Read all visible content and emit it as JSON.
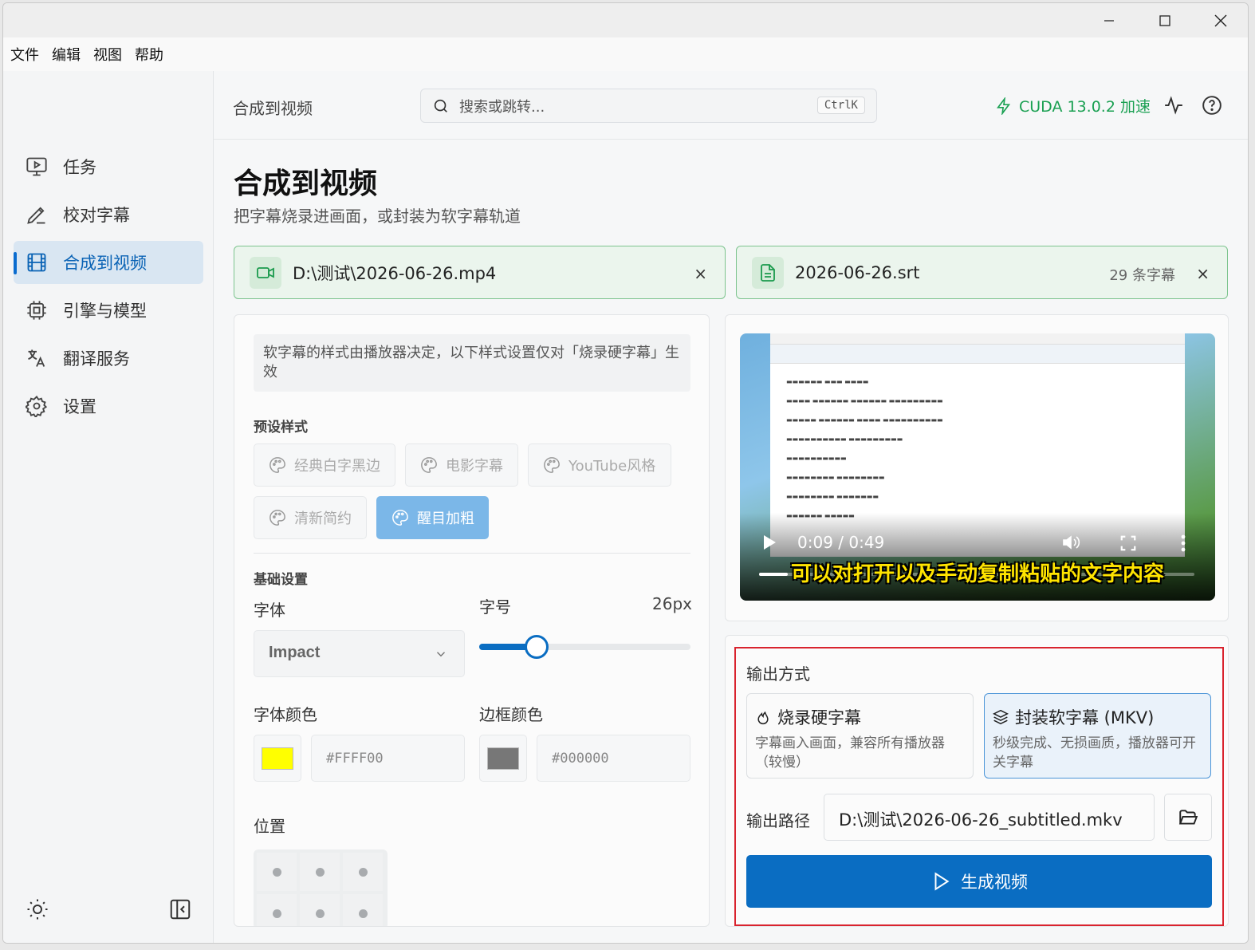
{
  "menu": [
    "文件",
    "编辑",
    "视图",
    "帮助"
  ],
  "sidebar": {
    "items": [
      {
        "label": "任务",
        "icon": "monitor-play-icon"
      },
      {
        "label": "校对字幕",
        "icon": "pen-icon"
      },
      {
        "label": "合成到视频",
        "icon": "film-icon",
        "active": true
      },
      {
        "label": "引擎与模型",
        "icon": "cpu-icon"
      },
      {
        "label": "翻译服务",
        "icon": "languages-icon"
      },
      {
        "label": "设置",
        "icon": "gear-icon"
      }
    ],
    "bottom_icons": [
      "sun-icon",
      "collapse-sidebar-icon"
    ]
  },
  "header": {
    "title": "合成到视频",
    "search_placeholder": "搜索或跳转...",
    "search_shortcut": "CtrlK",
    "cuda_label": "CUDA 13.0.2 加速",
    "cuda_color": "#1aa052"
  },
  "page": {
    "title": "合成到视频",
    "subtitle": "把字幕烧录进画面，或封装为软字幕轨道"
  },
  "files": {
    "video": {
      "name": "D:\\测试\\2026-06-26.mp4",
      "remove": "×"
    },
    "subtitle": {
      "name": "2026-06-26.srt",
      "count": "29 条字幕",
      "remove": "×"
    }
  },
  "style_panel": {
    "note": "软字幕的样式由播放器决定，以下样式设置仅对「烧录硬字幕」生效",
    "presets_label": "预设样式",
    "presets": [
      "经典白字黑边",
      "电影字幕",
      "YouTube风格",
      "清新简约",
      "醒目加粗"
    ],
    "active_preset": "醒目加粗",
    "basic_label": "基础设置",
    "font_label": "字体",
    "font_value": "Impact",
    "size_label": "字号",
    "size_value": "26px",
    "size_fraction": 0.27,
    "font_color_label": "字体颜色",
    "font_color_value": "#FFFF00",
    "border_color_label": "边框颜色",
    "border_color_value": "#000000",
    "border_swatch_color": "#777777",
    "position_label": "位置"
  },
  "preview": {
    "time": "0:09 / 0:49",
    "subtitle_text": "可以对打开以及手动复制粘贴的文字内容",
    "progress": 0.18
  },
  "output": {
    "title": "输出方式",
    "modes": [
      {
        "title": "烧录硬字幕",
        "desc": "字幕画入画面，兼容所有播放器（较慢）",
        "icon": "flame-icon"
      },
      {
        "title": "封装软字幕 (MKV)",
        "desc": "秒级完成、无损画质，播放器可开关字幕",
        "icon": "layers-icon",
        "active": true
      }
    ],
    "path_label": "输出路径",
    "path_value": "D:\\测试\\2026-06-26_subtitled.mkv",
    "generate_label": "生成视频"
  }
}
